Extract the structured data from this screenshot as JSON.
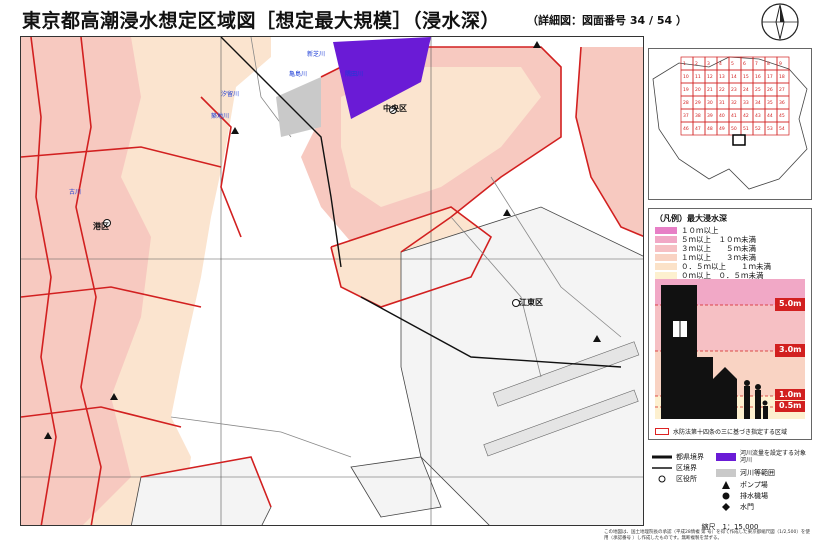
{
  "header": {
    "title": "東京都高潮浸水想定区域図［想定最大規模］（浸水深）",
    "detail": "（詳細図：図面番号 34 / 54 ）"
  },
  "map": {
    "labels": [
      {
        "text": "中央区"
      },
      {
        "text": "港区"
      },
      {
        "text": "江東区"
      },
      {
        "text": "亀島川"
      },
      {
        "text": "隅田川"
      },
      {
        "text": "築地川"
      },
      {
        "text": "古川"
      },
      {
        "text": "汐留川"
      },
      {
        "text": "新芝川"
      }
    ]
  },
  "index_map": {
    "numbers": [
      "1",
      "2",
      "3",
      "4",
      "5",
      "6",
      "7",
      "8",
      "9",
      "10",
      "11",
      "12",
      "13",
      "14",
      "15",
      "16",
      "17",
      "18",
      "19",
      "20",
      "21",
      "22",
      "23",
      "24",
      "25",
      "26",
      "27",
      "28",
      "29",
      "30",
      "31",
      "32",
      "33",
      "34",
      "35",
      "36",
      "37",
      "38",
      "39",
      "40",
      "41",
      "42",
      "43",
      "44",
      "45",
      "46",
      "47",
      "48",
      "49",
      "50",
      "51",
      "52",
      "53",
      "54"
    ]
  },
  "legend": {
    "head": "（凡例）最大浸水深",
    "rows": [
      {
        "label": "１０ｍ以上",
        "color": "#e77fc6"
      },
      {
        "label": "５ｍ以上　１０ｍ未満",
        "color": "#f1a8c6"
      },
      {
        "label": "３ｍ以上　　５ｍ未満",
        "color": "#f6c0c4"
      },
      {
        "label": "１ｍ以上　　３ｍ未満",
        "color": "#f9d3c3"
      },
      {
        "label": "０．５ｍ以上　　１ｍ未満",
        "color": "#fbe2c8"
      },
      {
        "label": "０ｍ以上　０．５ｍ未満",
        "color": "#fdf0cf"
      }
    ],
    "depth_marks": [
      "5.0m",
      "3.0m",
      "1.0m",
      "0.5m"
    ],
    "note": "水防法第十四条の三に基づき指定する区域"
  },
  "symbols": {
    "pref_border": "都県境界",
    "ward_border": "区境界",
    "ward_office": "区役所",
    "river_target": "河川流量を設定する対象河川",
    "river_area": "河川等範囲",
    "pump": "ポンプ場",
    "drain": "排水機場",
    "gate": "水門"
  },
  "scale": "縮尺　1：15,000",
  "footnote": "この地図は、国土地理院長の承認（平成28情複 第 号）を得て作成した東京都縮尺図（1/2,500）を使用（承認番号 ）し作成したものです。無断複製を禁ずる。",
  "colors": {
    "inundation": "#f7c9c0",
    "inundation_light": "#fbe4cf",
    "boundary": "#d22020",
    "river_target": "#6a1bd6",
    "river_area": "#c9c9c9"
  }
}
